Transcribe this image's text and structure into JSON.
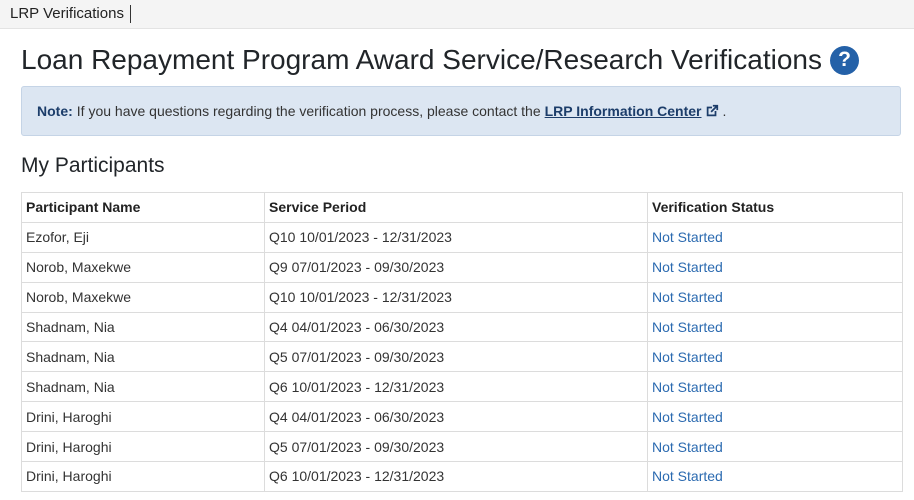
{
  "app": {
    "title": "LRP Verifications"
  },
  "page": {
    "title": "Loan Repayment Program Award Service/Research Verifications"
  },
  "note": {
    "label": "Note:",
    "text": "If you have questions regarding the verification process, please contact the",
    "link_text": "LRP Information Center",
    "end": "."
  },
  "section": {
    "title": "My Participants"
  },
  "table": {
    "headers": [
      "Participant Name",
      "Service Period",
      "Verification Status"
    ],
    "rows": [
      {
        "name": "Ezofor, Eji",
        "period": "Q10 10/01/2023 - 12/31/2023",
        "status": "Not Started"
      },
      {
        "name": "Norob, Maxekwe",
        "period": "Q9 07/01/2023 - 09/30/2023",
        "status": "Not Started"
      },
      {
        "name": "Norob, Maxekwe",
        "period": "Q10 10/01/2023 - 12/31/2023",
        "status": "Not Started"
      },
      {
        "name": "Shadnam, Nia",
        "period": "Q4 04/01/2023 - 06/30/2023",
        "status": "Not Started"
      },
      {
        "name": "Shadnam, Nia",
        "period": "Q5 07/01/2023 - 09/30/2023",
        "status": "Not Started"
      },
      {
        "name": "Shadnam, Nia",
        "period": "Q6 10/01/2023 - 12/31/2023",
        "status": "Not Started"
      },
      {
        "name": "Drini, Haroghi",
        "period": "Q4 04/01/2023 - 06/30/2023",
        "status": "Not Started"
      },
      {
        "name": "Drini, Haroghi",
        "period": "Q5 07/01/2023 - 09/30/2023",
        "status": "Not Started"
      },
      {
        "name": "Drini, Haroghi",
        "period": "Q6 10/01/2023 - 12/31/2023",
        "status": "Not Started"
      }
    ]
  },
  "colors": {
    "accent": "#2461a8",
    "note_bg": "#dce6f2",
    "link": "#2b6ab0"
  },
  "icons": {
    "help": "question-circle-icon",
    "external": "external-link-icon"
  }
}
